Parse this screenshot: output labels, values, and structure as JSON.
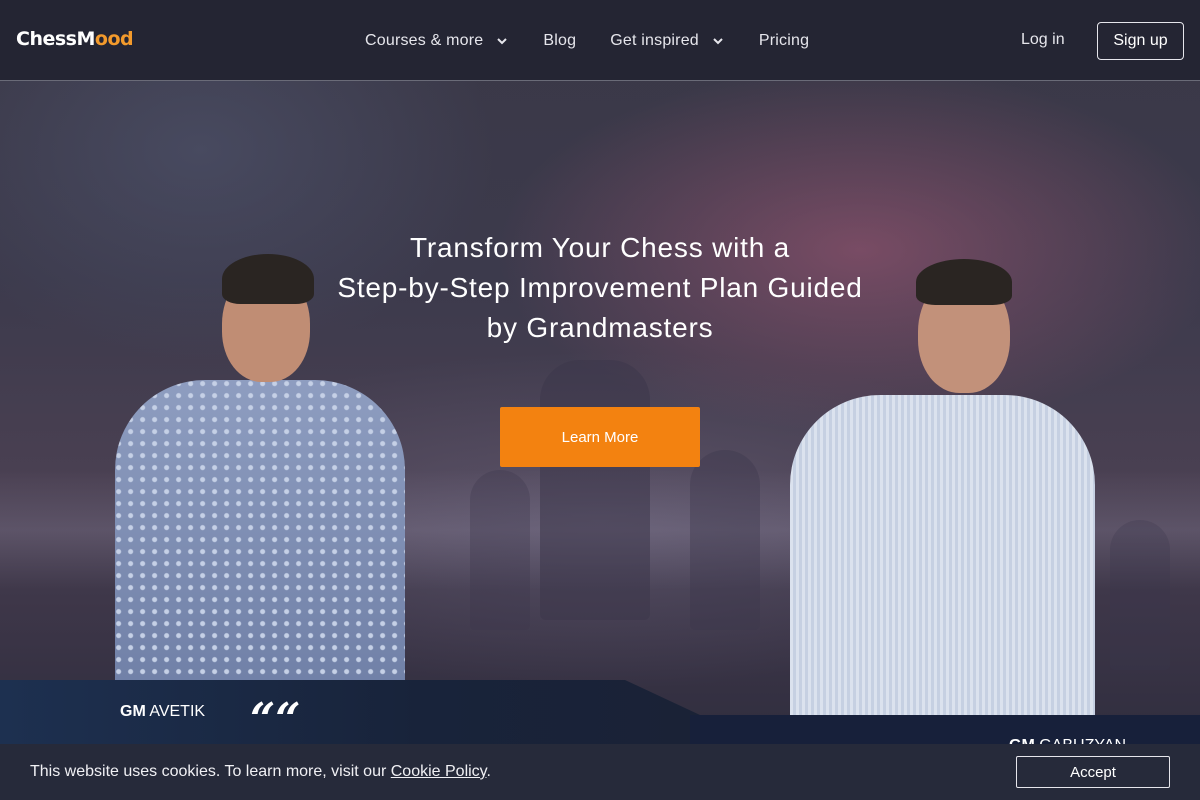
{
  "nav": {
    "logo_main": "ChessM",
    "logo_accent": "ood",
    "items": [
      {
        "label": "Courses & more",
        "has_dropdown": true
      },
      {
        "label": "Blog",
        "has_dropdown": false
      },
      {
        "label": "Get inspired",
        "has_dropdown": true
      },
      {
        "label": "Pricing",
        "has_dropdown": false
      }
    ],
    "login_label": "Log in",
    "signup_label": "Sign up"
  },
  "hero": {
    "headline_line1": "Transform Your Chess with a",
    "headline_line2": "Step-by-Step Improvement Plan Guided",
    "headline_line3": "by Grandmasters",
    "cta_label": "Learn More"
  },
  "coaches": {
    "left_title": "GM",
    "left_name": "AVETIK",
    "right_title": "GM",
    "right_name": "GABUZYAN"
  },
  "quote": {
    "mark": "““"
  },
  "cookie": {
    "text": "This website uses cookies. To learn more, visit our",
    "link_label": "Cookie Policy",
    "suffix": ".",
    "accept_label": "Accept"
  },
  "colors": {
    "accent": "#f38210",
    "logo_accent": "#f39a2c",
    "navbar_bg": "#242533",
    "cookie_bg": "#262a3a"
  },
  "icons": {
    "dropdown": "chevron-down-icon",
    "quote": "quote-icon"
  }
}
